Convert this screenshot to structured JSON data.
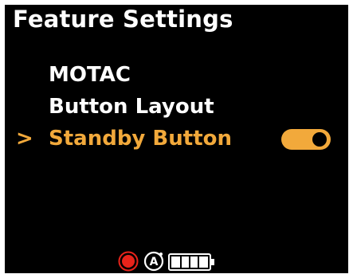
{
  "header": {
    "title": "Feature Settings"
  },
  "menu": {
    "items": [
      {
        "label": "MOTAC",
        "selected": false
      },
      {
        "label": "Button Layout",
        "selected": false
      },
      {
        "label": "Standby Button",
        "selected": true,
        "toggle": "on"
      }
    ],
    "selection_indicator": ">"
  },
  "status_bar": {
    "icons": [
      "record-icon",
      "auto-mode-icon",
      "battery-icon"
    ],
    "auto_letter": "A",
    "battery_level": 1.0
  },
  "colors": {
    "background": "#000000",
    "text": "#ffffff",
    "accent": "#f2a93b",
    "record": "#e8231a"
  }
}
